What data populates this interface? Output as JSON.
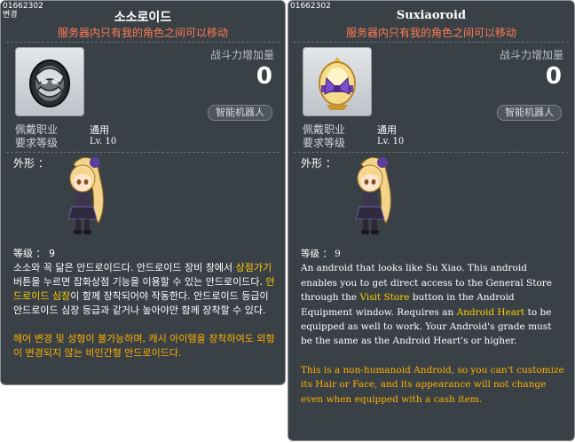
{
  "tooltips": [
    {
      "item_id": "01662302",
      "sub_label": "변경",
      "name": "소소로이드",
      "trade_note": "服务器内只有我的角色之间可以移动",
      "power_label": "战斗力增加量",
      "power_value": "0",
      "category_badge": "智能机器人",
      "req_job_label": "佩戴职业",
      "req_job_value": "通用",
      "req_level_label": "要求等级",
      "req_level_value": "Lv. 10",
      "appearance_label": "外形 ：",
      "grade_label": "等级 ： 9",
      "desc": {
        "p1": "소소와 꼭 닮은 안드로이드다. 안드로이드 장비 창에서 ",
        "h1": "상점가기",
        "p2": " 버튼을 누르면 잡화상점 기능을 이용할 수 있는 안드로이드다. ",
        "h2": "안드로이드 심장",
        "p3": "이 함께 장착되어야 작동한다. 안드로이드 등급이 안드로이드 심장 등급과 같거나 높아야만 함께 장착할 수 있다.",
        "note": "헤어 변경 및 성형이 불가능하며, 캐시 아이템을 장착하여도 외형이 변경되지 않는 비인간형 안드로이드다."
      },
      "icon": "dark-armored-egg-icon",
      "sprite": "blonde-android-girl-sprite"
    },
    {
      "item_id": "01662302",
      "name": "Suxiaoroid",
      "trade_note": "服务器内只有我的角色之间可以移动",
      "power_label": "战斗力增加量",
      "power_value": "0",
      "category_badge": "智能机器人",
      "req_job_label": "佩戴职业",
      "req_job_value": "通用",
      "req_level_label": "要求等级",
      "req_level_value": "Lv. 10",
      "appearance_label": "外形 ：",
      "grade_label": "等级 ： 9",
      "desc": {
        "p1": "An android that looks like Su Xiao. This android enables you to get direct access to the General Store through the ",
        "h1": "Visit Store",
        "p2": " button in the Android Equipment window. Requires an ",
        "h2": "Android Heart",
        "p3": " to be equipped as well to work. Your Android's grade must be the same as the Android Heart's or higher.",
        "note": "This is a non-humanoid Android, so you can't customize its Hair or Face, and its appearance will not change even when equipped with a cash item."
      },
      "icon": "golden-egg-purple-bow-icon",
      "sprite": "blonde-android-girl-sprite"
    }
  ],
  "colors": {
    "panel_bg": "#3a4146",
    "trade_note": "#ff7a55",
    "highlight": "#ffcc00",
    "note": "#ffb000"
  }
}
